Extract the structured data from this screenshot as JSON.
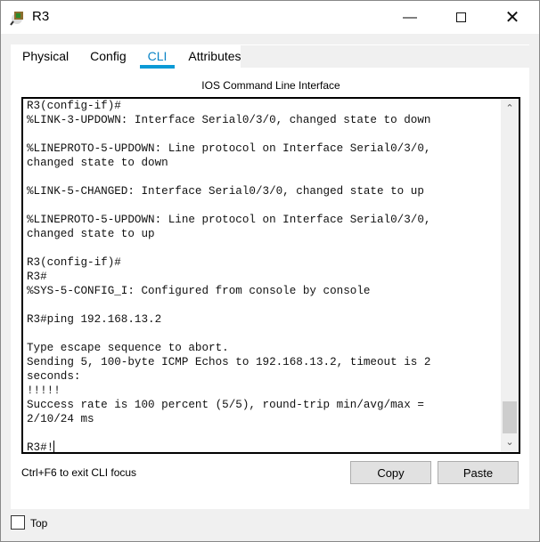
{
  "window": {
    "title": "R3",
    "icon": "router-icon",
    "controls": [
      "minimize",
      "maximize",
      "close"
    ]
  },
  "tabs": [
    {
      "label": "Physical"
    },
    {
      "label": "Config"
    },
    {
      "label": "CLI",
      "active": true
    },
    {
      "label": "Attributes"
    }
  ],
  "cli": {
    "heading": "IOS Command Line Interface",
    "lines": [
      "R3(config-if)#",
      "%LINK-3-UPDOWN: Interface Serial0/3/0, changed state to down",
      "",
      "%LINEPROTO-5-UPDOWN: Line protocol on Interface Serial0/3/0,",
      "changed state to down",
      "",
      "%LINK-5-CHANGED: Interface Serial0/3/0, changed state to up",
      "",
      "%LINEPROTO-5-UPDOWN: Line protocol on Interface Serial0/3/0,",
      "changed state to up",
      "",
      "R3(config-if)#",
      "R3#",
      "%SYS-5-CONFIG_I: Configured from console by console",
      "",
      "R3#ping 192.168.13.2",
      "",
      "Type escape sequence to abort.",
      "Sending 5, 100-byte ICMP Echos to 192.168.13.2, timeout is 2",
      "seconds:",
      "!!!!!",
      "Success rate is 100 percent (5/5), round-trip min/avg/max =",
      "2/10/24 ms",
      "",
      "R3#!"
    ],
    "hint": "Ctrl+F6 to exit CLI focus",
    "copy_label": "Copy",
    "paste_label": "Paste"
  },
  "footer": {
    "top_label": "Top",
    "top_checked": false
  }
}
